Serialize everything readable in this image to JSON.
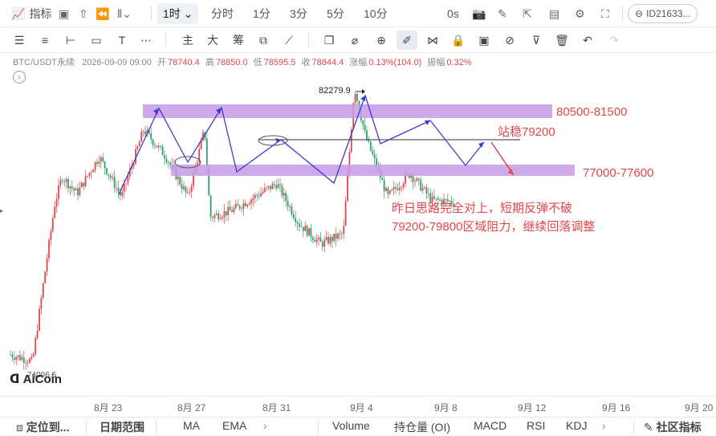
{
  "toolbar": {
    "indicators": "指标",
    "timeframe_selected": "1时",
    "timeframes": [
      "分时",
      "1分",
      "3分",
      "5分",
      "10分"
    ],
    "seconds": "0s",
    "account": "ID21633..."
  },
  "drawbar": {
    "main_label": "主",
    "big_label": "大",
    "chips_label": "筹"
  },
  "info": {
    "symbol": "BTC/USDT永续",
    "datetime": "2026-09-09 09:00",
    "open_label": "开",
    "open": "78740.4",
    "high_label": "高",
    "high": "78850.0",
    "low_label": "低",
    "low": "78595.5",
    "close_label": "收",
    "close": "78844.4",
    "change_label": "涨幅",
    "change": "0.13%(104.0)",
    "amp_label": "振幅",
    "amp": "0.32%"
  },
  "annotations": {
    "zone_upper": "80500-81500",
    "zone_lower": "77000-77600",
    "hold_level": "站稳79200",
    "peak_label": "82279.9",
    "low_label": "74096.5",
    "note_line1": "昨日思路完全对上，短期反弹不破",
    "note_line2": "79200-79800区域阻力，继续回落调整"
  },
  "colors": {
    "zone": "#c79be8",
    "drawing": "#3b3bcf",
    "up": "#e0464b",
    "down": "#2e9e6a",
    "annotation": "#e0464b"
  },
  "xaxis": {
    "ticks": [
      "8月 23",
      "8月 27",
      "8月 31",
      "9月 4",
      "9月 8",
      "9月 12",
      "9月 16",
      "9月 20"
    ]
  },
  "logo": "AiCoin",
  "bottom": {
    "locate": "定位到...",
    "date_range": "日期范围",
    "indicators": [
      "MA",
      "EMA",
      "Volume",
      "持仓量 (OI)",
      "MACD",
      "RSI",
      "KDJ"
    ],
    "community": "社区指标"
  },
  "chart_data": {
    "type": "candlestick",
    "symbol": "BTC/USDT永续",
    "interval": "1h",
    "price_range": [
      73500,
      83000
    ],
    "x_range": [
      "2026-08-20",
      "2026-09-20"
    ],
    "path": [
      [
        "2026-08-20",
        74300
      ],
      [
        "2026-08-21",
        74100
      ],
      [
        "2026-08-21 12:00",
        76500
      ],
      [
        "2026-08-22",
        78800
      ],
      [
        "2026-08-22 08:00",
        79600
      ],
      [
        "2026-08-23",
        79100
      ],
      [
        "2026-08-24",
        80200
      ],
      [
        "2026-08-25",
        79000
      ],
      [
        "2026-08-26",
        81000
      ],
      [
        "2026-08-27",
        80200
      ],
      [
        "2026-08-28",
        79000
      ],
      [
        "2026-08-28 18:00",
        81000
      ],
      [
        "2026-08-29",
        78400
      ],
      [
        "2026-08-30",
        78600
      ],
      [
        "2026-09-01",
        79400
      ],
      [
        "2026-09-02",
        78200
      ],
      [
        "2026-09-03",
        77600
      ],
      [
        "2026-09-04",
        77900
      ],
      [
        "2026-09-04 12:00",
        82280
      ],
      [
        "2026-09-05",
        80800
      ],
      [
        "2026-09-06",
        79000
      ],
      [
        "2026-09-07",
        79700
      ],
      [
        "2026-09-08",
        78900
      ],
      [
        "2026-09-09",
        78850
      ]
    ],
    "zones": [
      {
        "label": "80500-81500",
        "low": 80500,
        "high": 81500
      },
      {
        "label": "77000-77600",
        "low": 77000,
        "high": 77600
      }
    ],
    "levels": [
      79200
    ]
  }
}
